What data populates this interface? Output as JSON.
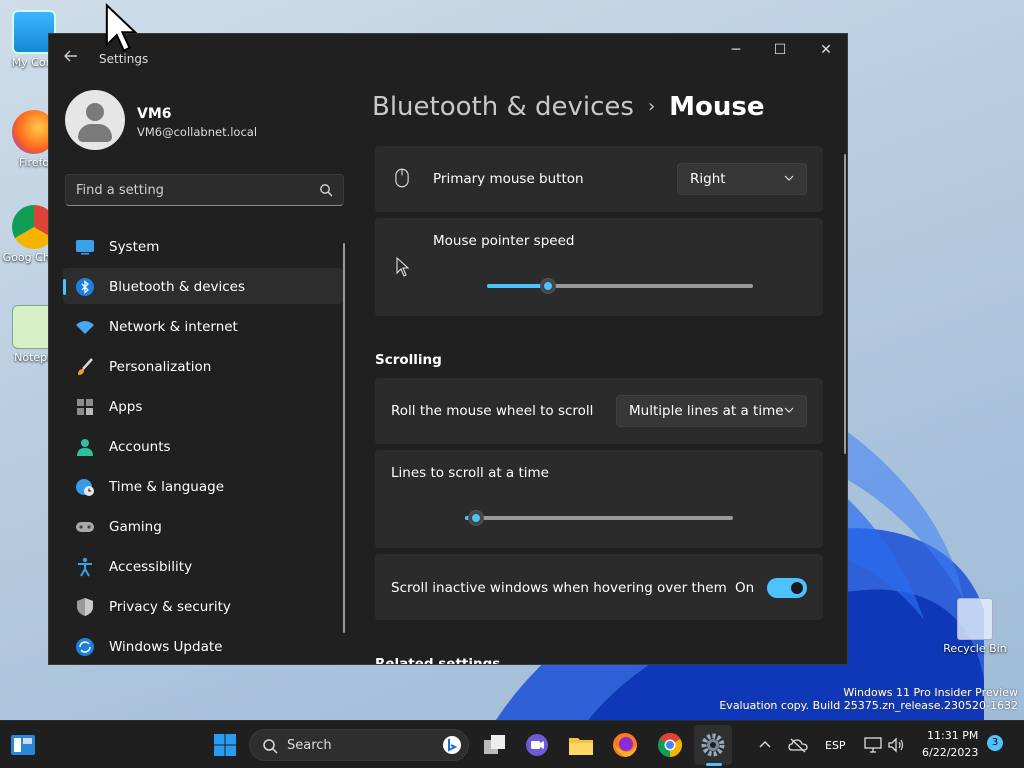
{
  "desktop": {
    "icons": [
      {
        "label": "My Com"
      },
      {
        "label": "Firefo"
      },
      {
        "label": "Goog Chror"
      },
      {
        "label": "Notepa"
      },
      {
        "label": "Recycle Bin"
      }
    ],
    "watermark": {
      "line1": "Windows 11 Pro Insider Preview",
      "line2": "Evaluation copy. Build 25375.zn_release.230520-1632"
    }
  },
  "window": {
    "title": "Settings",
    "controls": {
      "minimize": "─",
      "maximize": "☐",
      "close": "✕"
    }
  },
  "user": {
    "name": "VM6",
    "email": "VM6@collabnet.local"
  },
  "search": {
    "placeholder": "Find a setting"
  },
  "nav": [
    {
      "label": "System",
      "icon": "monitor-icon"
    },
    {
      "label": "Bluetooth & devices",
      "icon": "bluetooth-icon",
      "active": true
    },
    {
      "label": "Network & internet",
      "icon": "wifi-icon"
    },
    {
      "label": "Personalization",
      "icon": "brush-icon"
    },
    {
      "label": "Apps",
      "icon": "apps-icon"
    },
    {
      "label": "Accounts",
      "icon": "person-icon"
    },
    {
      "label": "Time & language",
      "icon": "globe-clock-icon"
    },
    {
      "label": "Gaming",
      "icon": "gamepad-icon"
    },
    {
      "label": "Accessibility",
      "icon": "accessibility-icon"
    },
    {
      "label": "Privacy & security",
      "icon": "shield-icon"
    },
    {
      "label": "Windows Update",
      "icon": "update-icon"
    }
  ],
  "breadcrumb": {
    "parent": "Bluetooth & devices",
    "separator": "›",
    "current": "Mouse"
  },
  "settings": {
    "primary_button": {
      "label": "Primary mouse button",
      "value": "Right"
    },
    "pointer_speed": {
      "label": "Mouse pointer speed",
      "fraction": 0.23
    },
    "scrolling_header": "Scrolling",
    "roll_wheel": {
      "label": "Roll the mouse wheel to scroll",
      "value": "Multiple lines at a time"
    },
    "lines_to_scroll": {
      "label": "Lines to scroll at a time",
      "fraction": 0.04
    },
    "scroll_inactive": {
      "label": "Scroll inactive windows when hovering over them",
      "state": "On"
    },
    "related_header": "Related settings"
  },
  "taskbar": {
    "search_label": "Search",
    "language": "ESP",
    "time": "11:31 PM",
    "date": "6/22/2023",
    "notification_count": "3"
  },
  "colors": {
    "accent": "#4cc2ff",
    "window_bg": "#202020",
    "card_bg": "#2b2b2b"
  }
}
